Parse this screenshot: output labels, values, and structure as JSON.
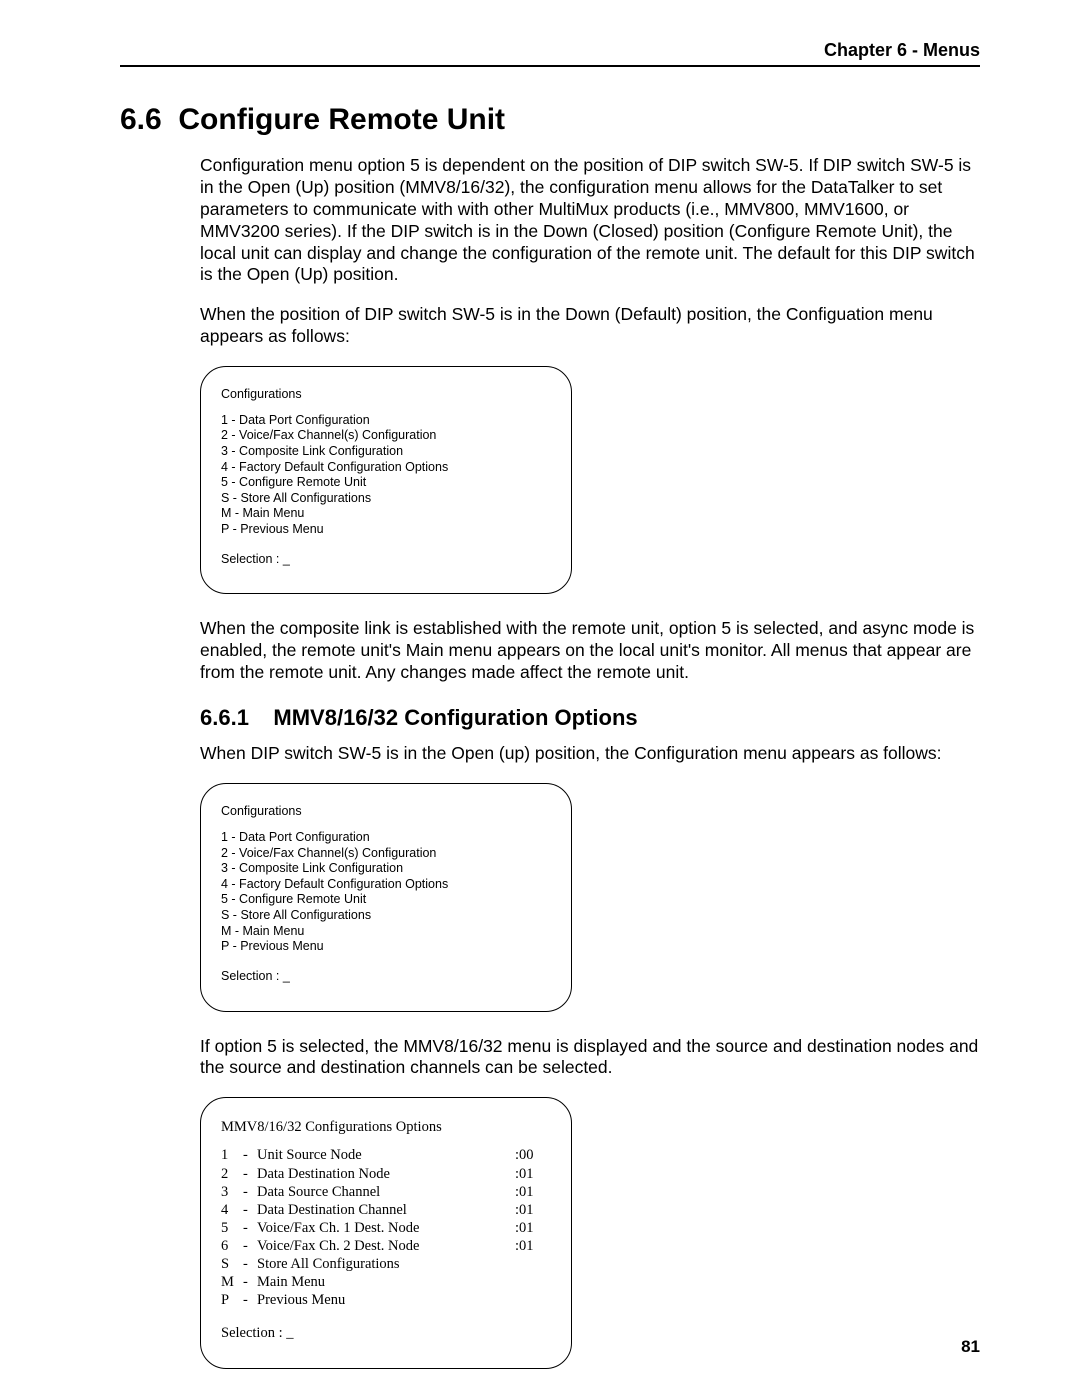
{
  "header": {
    "chapter": "Chapter 6 - Menus"
  },
  "section": {
    "number": "6.6",
    "title": "Configure Remote Unit"
  },
  "para1": "Configuration menu option 5 is dependent on the position of DIP switch SW-5.  If DIP switch SW-5 is in the Open (Up) position (MMV8/16/32), the configuration menu allows for the DataTalker to set parameters to communicate with with other MultiMux products (i.e., MMV800, MMV1600, or MMV3200 series).  If the DIP switch is in the Down (Closed) position (Configure Remote Unit), the local unit can display and change the configuration of the remote unit.  The default for this DIP switch is the Open (Up) position.",
  "para2": "When the position of DIP switch SW-5 is in the Down (Default) position, the Configuation menu appears as follows:",
  "menu1": {
    "title": "Configurations",
    "items": [
      "1 - Data Port Configuration",
      "2 - Voice/Fax Channel(s) Configuration",
      "3 - Composite Link Configuration",
      "4 - Factory Default Configuration Options",
      "5 - Configure Remote Unit",
      "S - Store All Configurations",
      "M - Main Menu",
      "P - Previous Menu"
    ],
    "prompt": "Selection : _"
  },
  "para3": "When the composite link is established with the remote unit, option 5 is selected, and async mode is enabled, the remote unit's Main menu appears on the local unit's monitor.  All menus that appear are from the remote unit.  Any changes made affect the remote unit.",
  "sub": {
    "number": "6.6.1",
    "title": "MMV8/16/32 Configuration Options"
  },
  "para4": "When DIP switch SW-5 is in the Open (up) position, the Configuration menu appears as follows:",
  "menu2": {
    "title": "Configurations",
    "items": [
      "1 - Data Port Configuration",
      "2 - Voice/Fax Channel(s) Configuration",
      "3 - Composite Link Configuration",
      "4 - Factory Default Configuration Options",
      "5 - Configure Remote Unit",
      "S - Store All Configurations",
      "M - Main Menu",
      "P - Previous Menu"
    ],
    "prompt": "Selection : _"
  },
  "para5": "If option 5 is selected, the MMV8/16/32 menu is displayed and the source and destination nodes and the source and destination channels can be selected.",
  "menu3": {
    "title": "MMV8/16/32 Configurations Options",
    "rows": [
      {
        "k": "1",
        "label": "Unit Source Node",
        "val": ":00"
      },
      {
        "k": "2",
        "label": "Data Destination Node",
        "val": ":01"
      },
      {
        "k": "3",
        "label": "Data Source Channel",
        "val": ":01"
      },
      {
        "k": "4",
        "label": "Data Destination Channel",
        "val": ":01"
      },
      {
        "k": "5",
        "label": "Voice/Fax Ch. 1 Dest. Node",
        "val": ":01"
      },
      {
        "k": "6",
        "label": "Voice/Fax Ch. 2 Dest. Node",
        "val": ":01"
      },
      {
        "k": "S",
        "label": "Store All Configurations",
        "val": ""
      },
      {
        "k": "M",
        "label": "Main Menu",
        "val": ""
      },
      {
        "k": "P",
        "label": "Previous Menu",
        "val": ""
      }
    ],
    "prompt": "Selection : _"
  },
  "page_number": "81"
}
